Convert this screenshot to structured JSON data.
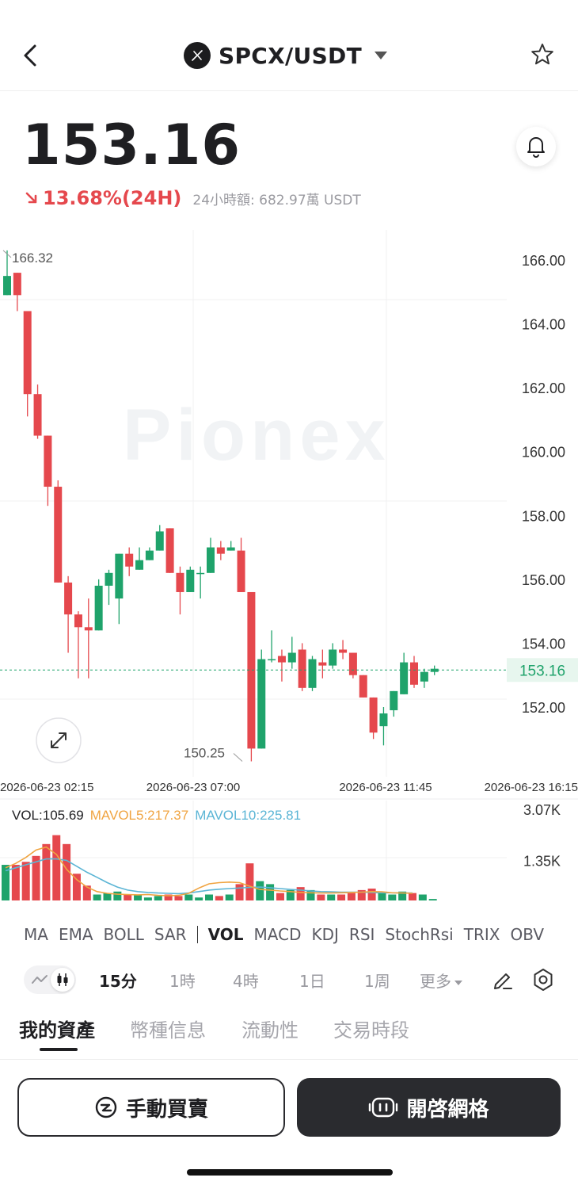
{
  "header": {
    "back_icon": "chevron-left-icon",
    "pair": "SPCX/USDT",
    "coin_icon": "spcx-logo-icon",
    "dropdown_icon": "caret-down-icon",
    "favorite_icon": "star-outline-icon"
  },
  "ticker": {
    "price": "153.16",
    "change": "13.68%(24H)",
    "change_direction": "down",
    "volume_24h": "24小時額: 682.97萬 USDT",
    "alert_icon": "bell-icon"
  },
  "colors": {
    "up": "#1fa36b",
    "down": "#e5484d",
    "mavol5": "#f0a441",
    "mavol10": "#5bb5d5",
    "text_dark": "#1f1f22"
  },
  "chart": {
    "watermark": "Pionex",
    "expand_icon": "expand-arrows-icon",
    "y_ticks": [
      "166.00",
      "164.00",
      "162.00",
      "160.00",
      "158.00",
      "156.00",
      "154.00",
      "152.00"
    ],
    "last_price_label": "153.16",
    "max_label": "166.32",
    "min_label": "150.25",
    "x_ticks": [
      "2026-06-23 02:15",
      "2026-06-23 07:00",
      "2026-06-23 11:45",
      "2026-06-23 16:15"
    ],
    "vol_label": "VOL:105.69",
    "mavol5_label": "MAVOL5:217.37",
    "mavol10_label": "MAVOL10:225.81",
    "vol_ticks": [
      "3.07K",
      "1.35K"
    ]
  },
  "chart_data": {
    "type": "candlestick",
    "y_range": [
      150.0,
      166.6
    ],
    "last_price": 153.16,
    "candles": [
      {
        "o": 164.9,
        "h": 166.3,
        "l": 164.9,
        "c": 165.5
      },
      {
        "o": 165.6,
        "h": 165.6,
        "l": 164.4,
        "c": 164.9
      },
      {
        "o": 164.4,
        "h": 164.4,
        "l": 161.1,
        "c": 161.8
      },
      {
        "o": 161.8,
        "h": 162.1,
        "l": 160.4,
        "c": 160.5
      },
      {
        "o": 160.5,
        "h": 160.5,
        "l": 158.3,
        "c": 158.9
      },
      {
        "o": 158.9,
        "h": 159.1,
        "l": 155.9,
        "c": 155.9
      },
      {
        "o": 155.9,
        "h": 156.1,
        "l": 153.7,
        "c": 154.9
      },
      {
        "o": 154.9,
        "h": 155.0,
        "l": 152.9,
        "c": 154.5
      },
      {
        "o": 154.5,
        "h": 155.4,
        "l": 152.9,
        "c": 154.4
      },
      {
        "o": 154.4,
        "h": 156.0,
        "l": 154.4,
        "c": 155.8
      },
      {
        "o": 155.8,
        "h": 156.3,
        "l": 155.2,
        "c": 156.2
      },
      {
        "o": 155.4,
        "h": 156.8,
        "l": 154.6,
        "c": 156.8
      },
      {
        "o": 156.8,
        "h": 157.0,
        "l": 156.1,
        "c": 156.4
      },
      {
        "o": 156.3,
        "h": 157.0,
        "l": 156.3,
        "c": 156.6
      },
      {
        "o": 156.6,
        "h": 157.0,
        "l": 156.6,
        "c": 156.9
      },
      {
        "o": 156.9,
        "h": 157.7,
        "l": 156.9,
        "c": 157.5
      },
      {
        "o": 157.6,
        "h": 157.6,
        "l": 156.2,
        "c": 156.2
      },
      {
        "o": 156.2,
        "h": 156.4,
        "l": 154.9,
        "c": 155.6
      },
      {
        "o": 155.6,
        "h": 156.4,
        "l": 155.6,
        "c": 156.3
      },
      {
        "o": 156.2,
        "h": 156.4,
        "l": 155.4,
        "c": 156.2
      },
      {
        "o": 156.2,
        "h": 157.3,
        "l": 156.2,
        "c": 157.0
      },
      {
        "o": 157.0,
        "h": 157.2,
        "l": 156.6,
        "c": 156.8
      },
      {
        "o": 156.9,
        "h": 157.2,
        "l": 156.9,
        "c": 157.0
      },
      {
        "o": 156.9,
        "h": 157.3,
        "l": 155.6,
        "c": 155.6
      },
      {
        "o": 155.6,
        "h": 155.6,
        "l": 150.3,
        "c": 150.7
      },
      {
        "o": 150.7,
        "h": 153.8,
        "l": 150.7,
        "c": 153.5
      },
      {
        "o": 153.5,
        "h": 154.4,
        "l": 153.4,
        "c": 153.5
      },
      {
        "o": 153.6,
        "h": 153.8,
        "l": 152.8,
        "c": 153.4
      },
      {
        "o": 153.4,
        "h": 154.2,
        "l": 153.2,
        "c": 153.7
      },
      {
        "o": 153.8,
        "h": 154.0,
        "l": 152.5,
        "c": 152.6
      },
      {
        "o": 152.6,
        "h": 153.6,
        "l": 152.5,
        "c": 153.5
      },
      {
        "o": 153.4,
        "h": 153.8,
        "l": 152.9,
        "c": 153.3
      },
      {
        "o": 153.3,
        "h": 154.0,
        "l": 153.2,
        "c": 153.8
      },
      {
        "o": 153.8,
        "h": 154.1,
        "l": 153.5,
        "c": 153.7
      },
      {
        "o": 153.7,
        "h": 153.7,
        "l": 152.9,
        "c": 153.0
      },
      {
        "o": 153.0,
        "h": 153.0,
        "l": 152.3,
        "c": 152.3
      },
      {
        "o": 152.3,
        "h": 152.3,
        "l": 151.0,
        "c": 151.2
      },
      {
        "o": 151.4,
        "h": 152.0,
        "l": 150.8,
        "c": 151.8
      },
      {
        "o": 151.9,
        "h": 152.5,
        "l": 151.7,
        "c": 152.5
      },
      {
        "o": 152.4,
        "h": 153.7,
        "l": 152.4,
        "c": 153.4
      },
      {
        "o": 153.4,
        "h": 153.6,
        "l": 152.6,
        "c": 152.7
      },
      {
        "o": 152.8,
        "h": 153.2,
        "l": 152.6,
        "c": 153.1
      },
      {
        "o": 153.1,
        "h": 153.3,
        "l": 153.0,
        "c": 153.2
      }
    ],
    "volume": [
      1.2,
      1.2,
      1.3,
      1.5,
      1.9,
      2.2,
      1.9,
      0.9,
      0.5,
      0.2,
      0.25,
      0.3,
      0.2,
      0.2,
      0.1,
      0.15,
      0.2,
      0.15,
      0.2,
      0.1,
      0.2,
      0.15,
      0.2,
      0.55,
      1.25,
      0.65,
      0.55,
      0.25,
      0.35,
      0.45,
      0.35,
      0.2,
      0.2,
      0.2,
      0.25,
      0.35,
      0.4,
      0.25,
      0.2,
      0.3,
      0.25,
      0.2,
      0.05
    ],
    "vol_range": [
      0,
      3.07
    ],
    "mavol5": [
      1.1,
      1.25,
      1.45,
      1.7,
      1.8,
      1.55,
      1.05,
      0.7,
      0.45,
      0.3,
      0.24,
      0.21,
      0.2,
      0.19,
      0.2,
      0.17,
      0.16,
      0.17,
      0.24,
      0.42,
      0.56,
      0.6,
      0.62,
      0.6,
      0.48,
      0.37,
      0.35,
      0.32,
      0.3,
      0.27,
      0.26,
      0.25,
      0.25,
      0.26,
      0.27,
      0.28,
      0.3,
      0.29,
      0.26,
      0.25,
      0.24
    ],
    "mavol10": [
      1.0,
      1.1,
      1.2,
      1.3,
      1.4,
      1.4,
      1.35,
      1.15,
      0.95,
      0.78,
      0.6,
      0.45,
      0.35,
      0.3,
      0.27,
      0.25,
      0.24,
      0.23,
      0.25,
      0.3,
      0.35,
      0.38,
      0.4,
      0.42,
      0.44,
      0.45,
      0.43,
      0.4,
      0.37,
      0.35,
      0.32,
      0.3,
      0.29,
      0.28,
      0.28,
      0.28,
      0.27,
      0.26,
      0.26,
      0.25,
      0.25
    ]
  },
  "indicators": [
    "MA",
    "EMA",
    "BOLL",
    "SAR",
    "VOL",
    "MACD",
    "KDJ",
    "RSI",
    "StochRsi",
    "TRIX",
    "OBV"
  ],
  "indicator_active": "VOL",
  "timeframes": {
    "chart_type_line_icon": "line-chart-icon",
    "chart_type_candle_icon": "candlestick-icon",
    "items": [
      "15分",
      "1時",
      "4時",
      "1日",
      "1周",
      "更多"
    ],
    "active": "15分",
    "draw_icon": "pen-draw-icon",
    "settings_icon": "gear-icon"
  },
  "sections": {
    "tabs": [
      "我的資產",
      "幣種信息",
      "流動性",
      "交易時段"
    ],
    "active": "我的資產"
  },
  "actions": {
    "manual_label": "手動買賣",
    "manual_icon": "manual-trade-icon",
    "grid_label": "開啓網格",
    "grid_icon": "grid-bot-icon"
  }
}
